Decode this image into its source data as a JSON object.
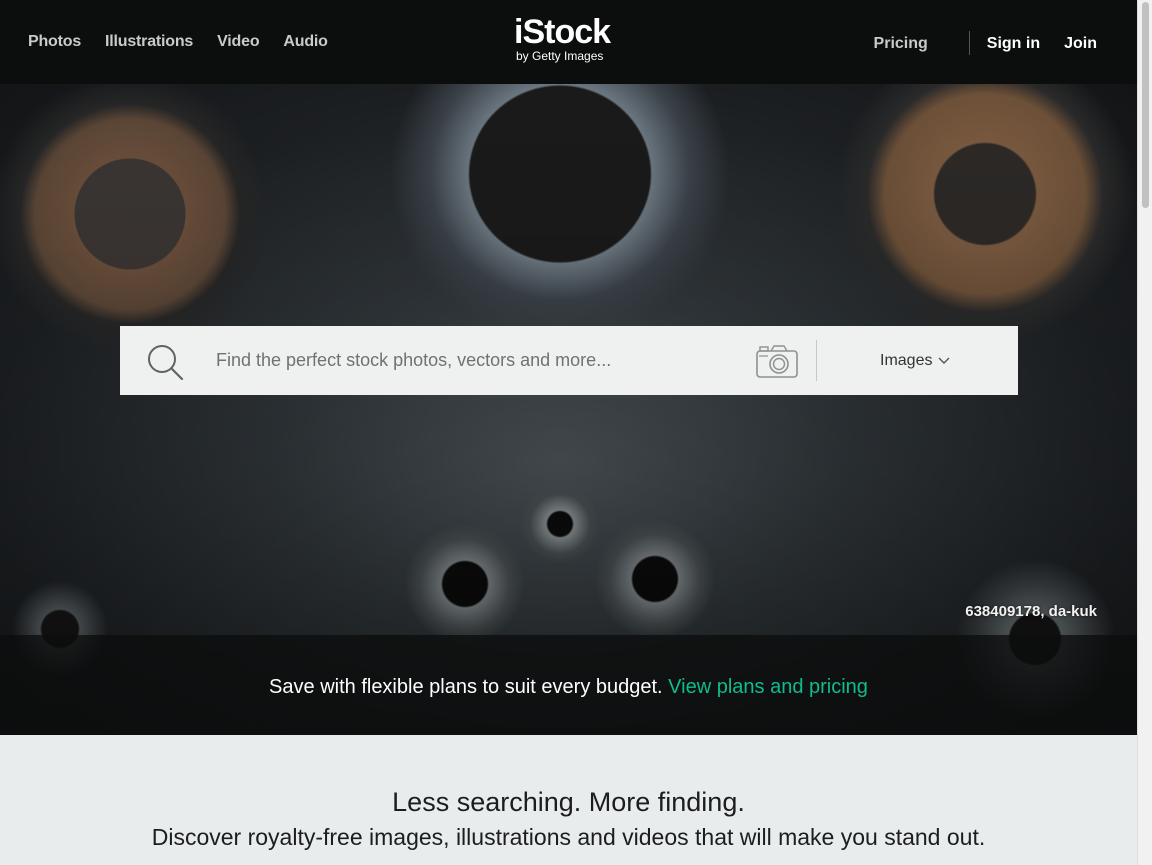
{
  "header": {
    "nav_left": [
      "Photos",
      "Illustrations",
      "Video",
      "Audio"
    ],
    "logo_main": "iStock",
    "logo_sub": "by Getty Images",
    "pricing_label": "Pricing",
    "signin_label": "Sign in",
    "join_label": "Join"
  },
  "search": {
    "placeholder": "Find the perfect stock photos, vectors and more...",
    "value": "",
    "type_selected": "Images"
  },
  "hero": {
    "credit": "638409178, da-kuk"
  },
  "promo": {
    "text": "Save with flexible plans to suit every budget.",
    "link": "View plans and pricing",
    "link_color": "#0fbc8e"
  },
  "tagline": {
    "title": "Less searching. More finding.",
    "subtitle": "Discover royalty-free images, illustrations and videos that will make you stand out."
  },
  "icons": [
    "search-icon",
    "camera-icon",
    "chevron-down-icon"
  ]
}
